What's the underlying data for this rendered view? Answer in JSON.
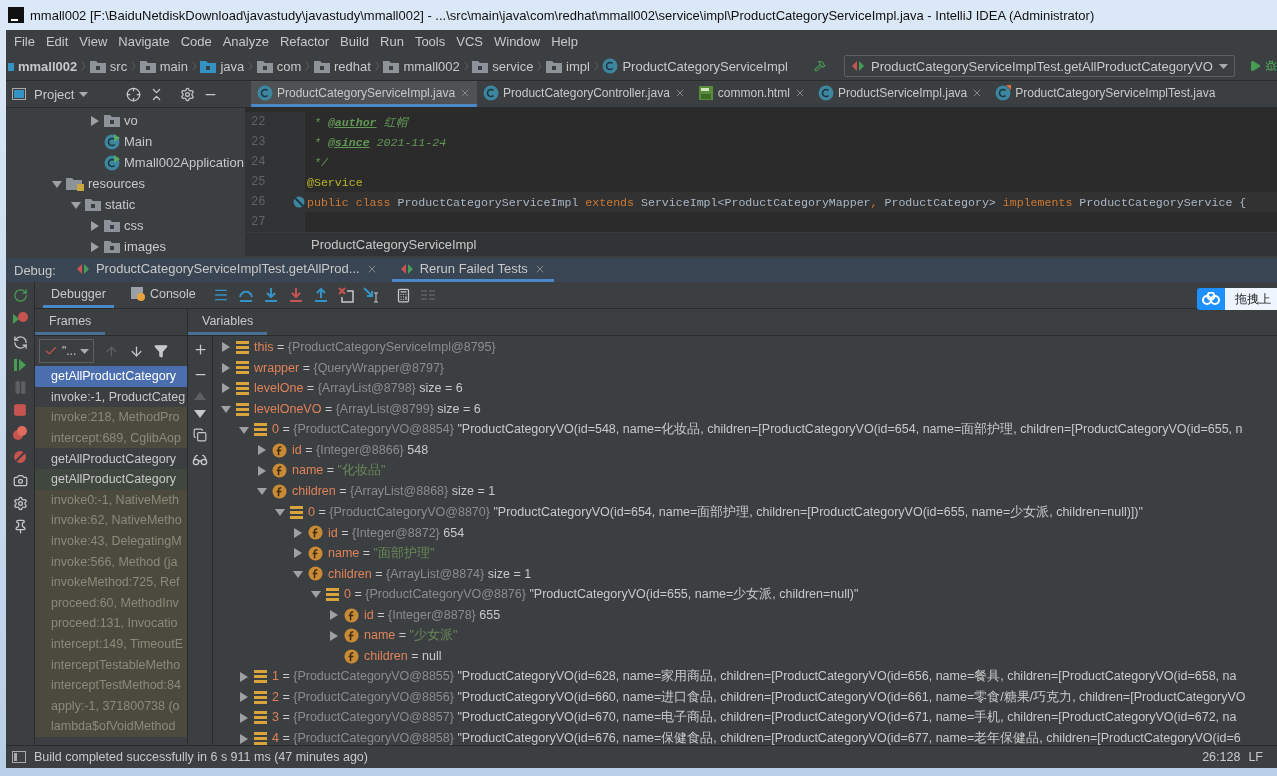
{
  "window": {
    "title": "mmall002 [F:\\BaiduNetdiskDownload\\javastudy\\javastudy\\mmall002] - ...\\src\\main\\java\\com\\redhat\\mmall002\\service\\impl\\ProductCategoryServiceImpl.java - IntelliJ IDEA (Administrator)"
  },
  "menu": [
    "File",
    "Edit",
    "View",
    "Navigate",
    "Code",
    "Analyze",
    "Refactor",
    "Build",
    "Run",
    "Tools",
    "VCS",
    "Window",
    "Help"
  ],
  "navbar": {
    "crumbs": [
      {
        "label": "mmall002",
        "kind": "project"
      },
      {
        "label": "src",
        "kind": "folder"
      },
      {
        "label": "main",
        "kind": "folder"
      },
      {
        "label": "java",
        "kind": "source"
      },
      {
        "label": "com",
        "kind": "package"
      },
      {
        "label": "redhat",
        "kind": "package"
      },
      {
        "label": "mmall002",
        "kind": "package"
      },
      {
        "label": "service",
        "kind": "package"
      },
      {
        "label": "impl",
        "kind": "package"
      },
      {
        "label": "ProductCategoryServiceImpl",
        "kind": "class"
      }
    ],
    "run_config": "ProductCategoryServiceImplTest.getAllProductCategoryVO"
  },
  "project_panel": {
    "title": "Project",
    "tree": [
      {
        "children": [
          {
            "children": [
              {
                "label": "vo",
                "kind": "package",
                "expanded": false
              },
              {
                "label": "Main",
                "kind": "runnable"
              },
              {
                "label": "Mmall002Application",
                "kind": "spring"
              }
            ]
          }
        ]
      },
      {
        "label": "resources",
        "kind": "resources",
        "expanded": true,
        "children": [
          {
            "label": "static",
            "kind": "package",
            "expanded": true,
            "children": [
              {
                "label": "css",
                "kind": "package",
                "expanded": false
              },
              {
                "label": "images",
                "kind": "package",
                "expanded": false
              }
            ]
          }
        ]
      }
    ]
  },
  "editor": {
    "tabs": [
      {
        "label": "ProductCategoryServiceImpl.java",
        "kind": "class",
        "selected": true
      },
      {
        "label": "ProductCategoryController.java",
        "kind": "class",
        "selected": false
      },
      {
        "label": "common.html",
        "kind": "html",
        "selected": false
      },
      {
        "label": "ProductServiceImpl.java",
        "kind": "class",
        "selected": false
      },
      {
        "label": "ProductCategoryServiceImplTest.java",
        "kind": "test",
        "selected": false
      }
    ],
    "lines": [
      {
        "number": "22",
        "current": false,
        "tokens": [
          {
            "text": " * ",
            "kind": "comment"
          },
          {
            "text": "@author",
            "kind": "tag"
          },
          {
            "text": " 红帽",
            "kind": "comment"
          }
        ]
      },
      {
        "number": "23",
        "current": false,
        "tokens": [
          {
            "text": " * ",
            "kind": "comment"
          },
          {
            "text": "@since",
            "kind": "tag"
          },
          {
            "text": " 2021-11-24",
            "kind": "comment"
          }
        ]
      },
      {
        "number": "24",
        "current": false,
        "tokens": [
          {
            "text": " */",
            "kind": "comment"
          }
        ]
      },
      {
        "number": "25",
        "current": false,
        "tokens": [
          {
            "text": "@Service",
            "kind": "annotation"
          }
        ]
      },
      {
        "number": "26",
        "current": true,
        "tokens": [
          {
            "text": "public class ",
            "kind": "keyword"
          },
          {
            "text": "ProductCategoryServiceImpl ",
            "kind": "plain"
          },
          {
            "text": "extends ",
            "kind": "keyword"
          },
          {
            "text": "ServiceImpl<ProductCategoryMapper",
            "kind": "plain"
          },
          {
            "text": ", ",
            "kind": "keyword"
          },
          {
            "text": "ProductCategory> ",
            "kind": "plain"
          },
          {
            "text": "implements ",
            "kind": "keyword"
          },
          {
            "text": "ProductCategoryService {",
            "kind": "plain"
          }
        ]
      },
      {
        "number": "27",
        "current": false
      }
    ],
    "breadcrumb": "ProductCategoryServiceImpl"
  },
  "debug": {
    "label": "Debug:",
    "tabs": [
      {
        "label": "ProductCategoryServiceImplTest.getAllProd...",
        "selected": false
      },
      {
        "label": "Rerun Failed Tests",
        "selected": true
      }
    ],
    "subtabs": [
      {
        "label": "Debugger",
        "kind": "debugger",
        "selected": true
      },
      {
        "label": "Console",
        "kind": "console",
        "selected": false
      }
    ],
    "frames": {
      "title": "Frames",
      "thread": "\"...",
      "items": [
        {
          "label": "getAllProductCategory",
          "kind": "app",
          "selected": true
        },
        {
          "label": "invoke:-1, ProductCateg",
          "kind": "app",
          "selected": false
        },
        {
          "label": "invoke:218, MethodPro",
          "kind": "library",
          "selected": false
        },
        {
          "label": "intercept:689, CglibAop",
          "kind": "library",
          "selected": false
        },
        {
          "label": "getAllProductCategory",
          "kind": "app",
          "selected": false
        },
        {
          "label": "getAllProductCategory",
          "kind": "marked",
          "selected": false
        },
        {
          "label": "invoke0:-1, NativeMeth",
          "kind": "library",
          "selected": false
        },
        {
          "label": "invoke:62, NativeMetho",
          "kind": "library",
          "selected": false
        },
        {
          "label": "invoke:43, DelegatingM",
          "kind": "library",
          "selected": false
        },
        {
          "label": "invoke:566, Method (ja",
          "kind": "library",
          "selected": false
        },
        {
          "label": "invokeMethod:725, Ref",
          "kind": "library",
          "selected": false
        },
        {
          "label": "proceed:60, MethodInv",
          "kind": "library",
          "selected": false
        },
        {
          "label": "proceed:131, Invocatio",
          "kind": "library",
          "selected": false
        },
        {
          "label": "intercept:149, TimeoutE",
          "kind": "library",
          "selected": false
        },
        {
          "label": "interceptTestableMetho",
          "kind": "library",
          "selected": false
        },
        {
          "label": "interceptTestMethod:84",
          "kind": "library",
          "selected": false
        },
        {
          "label": "apply:-1, 371800738 (o",
          "kind": "library",
          "selected": false
        },
        {
          "label": "lambda$ofVoidMethod",
          "kind": "library",
          "selected": false
        }
      ]
    },
    "variables": {
      "title": "Variables",
      "items": [
        {
          "name": "this",
          "sep": "=",
          "kind": "local",
          "expanded": false,
          "ref": "{ProductCategoryServiceImpl@8795}"
        },
        {
          "name": "wrapper",
          "sep": "=",
          "kind": "local",
          "expanded": false,
          "ref": "{QueryWrapper@8797}"
        },
        {
          "name": "levelOne",
          "sep": "=",
          "kind": "local",
          "expanded": false,
          "ref": "{ArrayList@8798}",
          "value": "size = 6"
        },
        {
          "name": "levelOneVO",
          "sep": "=",
          "kind": "local",
          "expanded": true,
          "ref": "{ArrayList@8799}",
          "value": "size = 6",
          "children": [
            {
              "name": "0",
              "sep": "=",
              "kind": "local",
              "expanded": true,
              "ref": "{ProductCategoryVO@8854}",
              "value": "\"ProductCategoryVO(id=548, name=化妆品, children=[ProductCategoryVO(id=654, name=面部护理, children=[ProductCategoryVO(id=655, n",
              "children": [
                {
                  "name": "id",
                  "sep": "=",
                  "kind": "field",
                  "expanded": false,
                  "ref": "{Integer@8866}",
                  "value": "548"
                },
                {
                  "name": "name",
                  "sep": "=",
                  "kind": "field",
                  "expanded": false,
                  "string": "\"化妆品\""
                },
                {
                  "name": "children",
                  "sep": "=",
                  "kind": "field",
                  "expanded": true,
                  "ref": "{ArrayList@8868}",
                  "value": "size = 1",
                  "children": [
                    {
                      "name": "0",
                      "sep": "=",
                      "kind": "local",
                      "expanded": true,
                      "ref": "{ProductCategoryVO@8870}",
                      "value": "\"ProductCategoryVO(id=654, name=面部护理, children=[ProductCategoryVO(id=655, name=少女派, children=null)])\"",
                      "children": [
                        {
                          "name": "id",
                          "sep": "=",
                          "kind": "field",
                          "expanded": false,
                          "ref": "{Integer@8872}",
                          "value": "654"
                        },
                        {
                          "name": "name",
                          "sep": "=",
                          "kind": "field",
                          "expanded": false,
                          "string": "\"面部护理\""
                        },
                        {
                          "name": "children",
                          "sep": "=",
                          "kind": "field",
                          "expanded": true,
                          "ref": "{ArrayList@8874}",
                          "value": "size = 1",
                          "children": [
                            {
                              "name": "0",
                              "sep": "=",
                              "kind": "local",
                              "expanded": true,
                              "ref": "{ProductCategoryVO@8876}",
                              "value": "\"ProductCategoryVO(id=655, name=少女派, children=null)\"",
                              "children": [
                                {
                                  "name": "id",
                                  "sep": "=",
                                  "kind": "field",
                                  "expanded": false,
                                  "ref": "{Integer@8878}",
                                  "value": "655"
                                },
                                {
                                  "name": "name",
                                  "sep": "=",
                                  "kind": "field",
                                  "expanded": false,
                                  "string": "\"少女派\""
                                },
                                {
                                  "name": "children",
                                  "sep": "=",
                                  "kind": "field",
                                  "value": "null"
                                }
                              ]
                            }
                          ]
                        }
                      ]
                    }
                  ]
                }
              ]
            },
            {
              "name": "1",
              "sep": "=",
              "kind": "local",
              "expanded": false,
              "ref": "{ProductCategoryVO@8855}",
              "value": "\"ProductCategoryVO(id=628, name=家用商品, children=[ProductCategoryVO(id=656, name=餐具, children=[ProductCategoryVO(id=658, na"
            },
            {
              "name": "2",
              "sep": "=",
              "kind": "local",
              "expanded": false,
              "ref": "{ProductCategoryVO@8856}",
              "value": "\"ProductCategoryVO(id=660, name=进口食品, children=[ProductCategoryVO(id=661, name=零食/糖果/巧克力, children=[ProductCategoryVO"
            },
            {
              "name": "3",
              "sep": "=",
              "kind": "local",
              "expanded": false,
              "ref": "{ProductCategoryVO@8857}",
              "value": "\"ProductCategoryVO(id=670, name=电子商品, children=[ProductCategoryVO(id=671, name=手机, children=[ProductCategoryVO(id=672, na"
            },
            {
              "name": "4",
              "sep": "=",
              "kind": "local",
              "expanded": false,
              "ref": "{ProductCategoryVO@8858}",
              "value": "\"ProductCategoryVO(id=676, name=保健食品, children=[ProductCategoryVO(id=677, name=老年保健品, children=[ProductCategoryVO(id=6"
            }
          ]
        }
      ]
    }
  },
  "overlay": {
    "label": "拖拽上"
  },
  "status_bar": {
    "message": "Build completed successfully in 6 s 911 ms (47 minutes ago)",
    "position": "26:128",
    "line_separator": "LF"
  }
}
